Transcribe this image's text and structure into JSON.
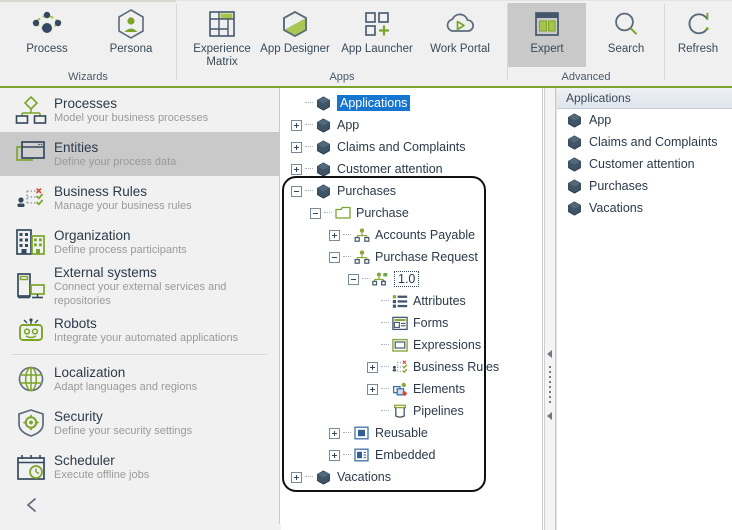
{
  "ribbon": {
    "groups": [
      {
        "name": "Wizards",
        "label": "Wizards"
      },
      {
        "name": "Apps",
        "label": "Apps"
      },
      {
        "name": "Advanced",
        "label": "Advanced"
      }
    ],
    "buttons": [
      {
        "name": "process",
        "label": "Process",
        "icon": "process-network-icon",
        "selected": false
      },
      {
        "name": "persona",
        "label": "Persona",
        "icon": "persona-icon",
        "selected": false
      },
      {
        "name": "experience-matrix",
        "label": "Experience Matrix",
        "icon": "experience-matrix-icon",
        "selected": false
      },
      {
        "name": "app-designer",
        "label": "App Designer",
        "icon": "app-designer-icon",
        "selected": false
      },
      {
        "name": "app-launcher",
        "label": "App Launcher",
        "icon": "app-launcher-icon",
        "selected": false
      },
      {
        "name": "work-portal",
        "label": "Work Portal",
        "icon": "work-portal-cloud-icon",
        "selected": false
      },
      {
        "name": "expert",
        "label": "Expert",
        "icon": "expert-panel-icon",
        "selected": true
      },
      {
        "name": "search",
        "label": "Search",
        "icon": "search-icon",
        "selected": false
      },
      {
        "name": "refresh",
        "label": "Refresh",
        "icon": "refresh-icon",
        "selected": false
      }
    ]
  },
  "sidebar": {
    "items": [
      {
        "title": "Processes",
        "subtitle": "Model your business processes",
        "icon": "processes-icon",
        "active": false
      },
      {
        "title": "Entities",
        "subtitle": "Define your process data",
        "icon": "entities-icon",
        "active": true
      },
      {
        "title": "Business Rules",
        "subtitle": "Manage your business rules",
        "icon": "business-rules-icon",
        "active": false
      },
      {
        "title": "Organization",
        "subtitle": "Define process participants",
        "icon": "organization-icon",
        "active": false
      },
      {
        "title": "External systems",
        "subtitle": "Connect your external services and repositories",
        "icon": "external-systems-icon",
        "active": false
      },
      {
        "title": "Robots",
        "subtitle": "Integrate your automated applications",
        "icon": "robots-icon",
        "active": false
      },
      {
        "title": "Localization",
        "subtitle": "Adapt languages and regions",
        "icon": "localization-icon",
        "active": false
      },
      {
        "title": "Security",
        "subtitle": "Define your security settings",
        "icon": "security-shield-icon",
        "active": false
      },
      {
        "title": "Scheduler",
        "subtitle": "Execute offline jobs",
        "icon": "scheduler-calendar-icon",
        "active": false
      }
    ],
    "collapse_icon": "chevron-left-icon"
  },
  "tree": {
    "nodes": [
      {
        "label": "Applications",
        "indent": 0,
        "expander": "none",
        "icon": "application-module-icon",
        "selected": true,
        "focus": false
      },
      {
        "label": "App",
        "indent": 0,
        "expander": "plus",
        "icon": "application-module-icon",
        "selected": false,
        "focus": false
      },
      {
        "label": "Claims and Complaints",
        "indent": 0,
        "expander": "plus",
        "icon": "application-module-icon",
        "selected": false,
        "focus": false
      },
      {
        "label": "Customer attention",
        "indent": 0,
        "expander": "plus",
        "icon": "application-module-icon",
        "selected": false,
        "focus": false
      },
      {
        "label": "Purchases",
        "indent": 0,
        "expander": "minus",
        "icon": "application-module-icon",
        "selected": false,
        "focus": false
      },
      {
        "label": "Purchase",
        "indent": 1,
        "expander": "minus",
        "icon": "folder-icon",
        "selected": false,
        "focus": false
      },
      {
        "label": "Accounts Payable",
        "indent": 2,
        "expander": "plus",
        "icon": "entity-icon",
        "selected": false,
        "focus": false
      },
      {
        "label": "Purchase Request",
        "indent": 2,
        "expander": "minus",
        "icon": "entity-icon",
        "selected": false,
        "focus": false
      },
      {
        "label": "1.0",
        "indent": 3,
        "expander": "minus",
        "icon": "entity-version-icon",
        "selected": false,
        "focus": true
      },
      {
        "label": "Attributes",
        "indent": 4,
        "expander": "none",
        "icon": "attributes-icon",
        "selected": false,
        "focus": false
      },
      {
        "label": "Forms",
        "indent": 4,
        "expander": "none",
        "icon": "forms-icon",
        "selected": false,
        "focus": false
      },
      {
        "label": "Expressions",
        "indent": 4,
        "expander": "none",
        "icon": "expressions-icon",
        "selected": false,
        "focus": false
      },
      {
        "label": "Business Rules",
        "indent": 4,
        "expander": "plus",
        "icon": "business-rules-small-icon",
        "selected": false,
        "focus": false
      },
      {
        "label": "Elements",
        "indent": 4,
        "expander": "plus",
        "icon": "elements-icon",
        "selected": false,
        "focus": false
      },
      {
        "label": "Pipelines",
        "indent": 4,
        "expander": "none",
        "icon": "pipelines-icon",
        "selected": false,
        "focus": false
      },
      {
        "label": "Reusable",
        "indent": 2,
        "expander": "plus",
        "icon": "reusable-icon",
        "selected": false,
        "focus": false
      },
      {
        "label": "Embedded",
        "indent": 2,
        "expander": "plus",
        "icon": "embedded-icon",
        "selected": false,
        "focus": false
      },
      {
        "label": "Vacations",
        "indent": 0,
        "expander": "plus",
        "icon": "application-module-icon",
        "selected": false,
        "focus": false
      }
    ]
  },
  "right_panel": {
    "header": "Applications",
    "rows": [
      {
        "label": "App",
        "icon": "application-module-icon"
      },
      {
        "label": "Claims and Complaints",
        "icon": "application-module-icon"
      },
      {
        "label": "Customer attention",
        "icon": "application-module-icon"
      },
      {
        "label": "Purchases",
        "icon": "application-module-icon"
      },
      {
        "label": "Vacations",
        "icon": "application-module-icon"
      }
    ]
  },
  "colors": {
    "accent_green": "#7ba428",
    "selection_blue": "#1675d1",
    "dark_navy": "#34495e",
    "ribbon_bg": "#f0f0f0",
    "sidebar_bg": "#f1f1f1",
    "active_gray": "#c9c9c9"
  }
}
